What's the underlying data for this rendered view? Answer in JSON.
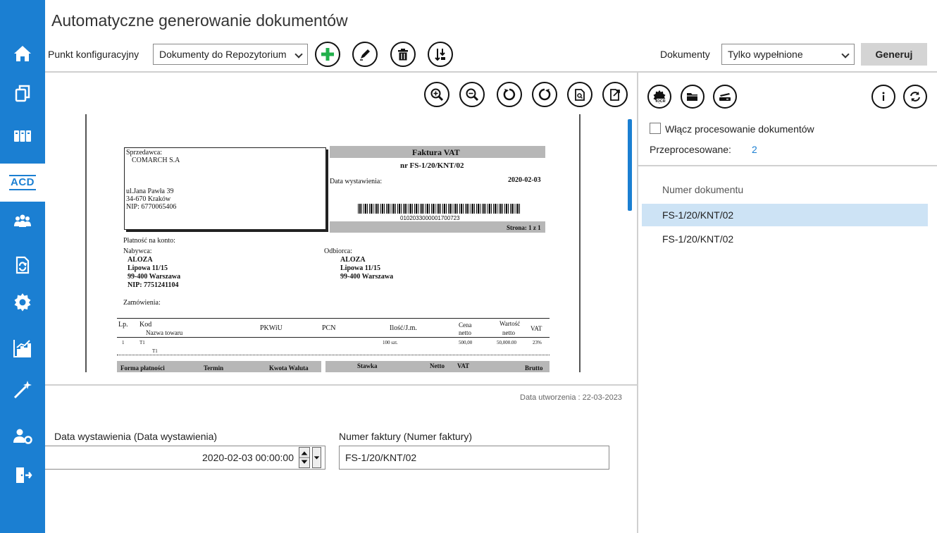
{
  "header": {
    "title": "Automatyczne generowanie dokumentów",
    "config_label": "Punkt konfiguracyjny",
    "config_value": "Dokumenty do Repozytorium",
    "documents_label": "Dokumenty",
    "documents_value": "Tylko wypełnione",
    "generate_label": "Generuj"
  },
  "sidebar": {
    "items": [
      {
        "icon": "home-icon"
      },
      {
        "icon": "documents-icon"
      },
      {
        "icon": "binders-icon"
      },
      {
        "icon": "acd-icon",
        "label": "ACD",
        "active": true
      },
      {
        "icon": "users-icon"
      },
      {
        "icon": "document-sync-icon"
      },
      {
        "icon": "gear-icon"
      },
      {
        "icon": "chart-icon"
      },
      {
        "icon": "magic-wand-icon"
      },
      {
        "icon": "user-settings-icon"
      },
      {
        "icon": "exit-door-icon"
      }
    ]
  },
  "right_panel": {
    "enable_processing_label": "Włącz procesowanie dokumentów",
    "enable_processing_checked": false,
    "processed_label": "Przeprocesowane:",
    "processed_count": "2",
    "list_header": "Numer dokumentu",
    "rows": [
      "FS-1/20/KNT/02",
      "FS-1/20/KNT/02"
    ],
    "selected_row": 0
  },
  "form": {
    "created_label": "Data utworzenia : 22-03-2023",
    "issue_date_label": "Data wystawienia (Data wystawienia)",
    "issue_date_value": "2020-02-03  00:00:00",
    "invoice_number_label": "Numer faktury (Numer faktury)",
    "invoice_number_value": "FS-1/20/KNT/02"
  },
  "invoice": {
    "seller_label": "Sprzedawca:",
    "seller_name": "COMARCH S.A",
    "seller_street": "ul.Jana Pawła 39",
    "seller_city": "34-670 Kraków",
    "seller_nip": "NIP: 6770065406",
    "doc_title": "Faktura VAT",
    "doc_number": "nr FS-1/20/KNT/02",
    "issue_label": "Data wystawienia:",
    "issue_value": "2020-02-03",
    "barcode_text": "0102033000001700723",
    "page": "Strona: 1 z 1",
    "payment_label": "Płatność na konto:",
    "buyer_label": "Nabywca:",
    "buyer_name": "ALOZA",
    "buyer_street": "Lipowa 11/15",
    "buyer_city": "99-400  Warszawa",
    "buyer_nip": "NIP: 7751241104",
    "recipient_label": "Odbiorca:",
    "recipient_name": "ALOZA",
    "recipient_street": "Lipowa 11/15",
    "recipient_city": "99-400  Warszawa",
    "orders_label": "Zamówienia:",
    "columns": {
      "lp": "Lp.",
      "kod": "Kod",
      "name": "Nazwa towaru",
      "pkwiu": "PKWiU",
      "pcn": "PCN",
      "qty": "Ilość/J.m.",
      "price": "Cena",
      "price2": "netto",
      "value": "Wartość",
      "value2": "netto",
      "vat": "VAT"
    },
    "row": {
      "lp": "1",
      "kod": "T1",
      "name": "T1",
      "qty": "100 szt.",
      "price": "500,00",
      "value": "50,000.00",
      "vat": "23%"
    },
    "footer": {
      "payment_form": "Forma płatności",
      "term": "Termin",
      "amount": "Kwota Waluta",
      "rate": "Stawka",
      "net": "Netto",
      "vat": "VAT",
      "gross": "Brutto"
    }
  }
}
